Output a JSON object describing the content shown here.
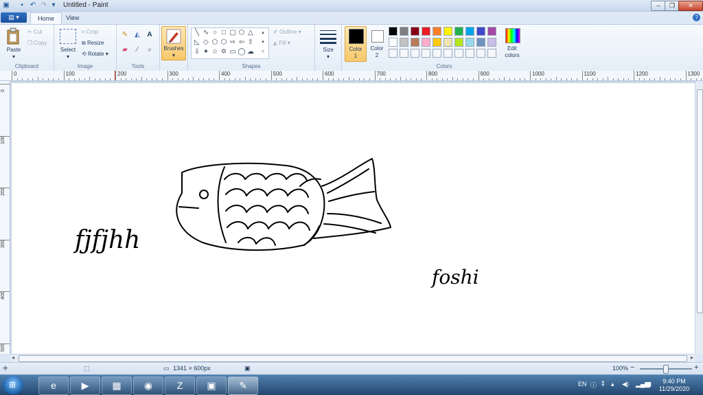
{
  "window": {
    "title": "Untitled - Paint",
    "quick_access": [
      "save-icon",
      "undo-icon",
      "redo-icon",
      "dropdown-icon"
    ],
    "minimize": "–",
    "maximize": "❐",
    "close": "✕"
  },
  "tabs": {
    "file": "▤ ▾",
    "home": "Home",
    "view": "View",
    "help": "?"
  },
  "ribbon": {
    "clipboard": {
      "label": "Clipboard",
      "paste": "Paste",
      "cut": "Cut",
      "copy": "Copy"
    },
    "image": {
      "label": "Image",
      "select": "Select",
      "crop": "Crop",
      "resize": "Resize",
      "rotate": "Rotate ▾"
    },
    "tools": {
      "label": "Tools"
    },
    "brushes": {
      "label": "Brushes"
    },
    "shapes": {
      "label": "Shapes",
      "outline": "Outline ▾",
      "fill": "Fill ▾"
    },
    "size": {
      "label": "Size"
    },
    "color1": {
      "label_line1": "Color",
      "label_line2": "1",
      "value": "#000000"
    },
    "color2": {
      "label_line1": "Color",
      "label_line2": "2",
      "value": "#ffffff"
    },
    "colors": {
      "label": "Colors",
      "row1": [
        "#000000",
        "#7f7f7f",
        "#880015",
        "#ed1c24",
        "#ff7f27",
        "#fff200",
        "#22b14c",
        "#00a2e8",
        "#3f48cc",
        "#a349a4"
      ],
      "row2": [
        "#ffffff",
        "#c3c3c3",
        "#b97a57",
        "#ffaec9",
        "#ffc90e",
        "#efe4b0",
        "#b5e61d",
        "#99d9ea",
        "#7092be",
        "#c8bfe7"
      ],
      "row3": [
        "#f5f7fb",
        "#f5f7fb",
        "#f5f7fb",
        "#f5f7fb",
        "#f5f7fb",
        "#f5f7fb",
        "#f5f7fb",
        "#f5f7fb",
        "#f5f7fb",
        "#f5f7fb"
      ]
    },
    "edit_colors": {
      "line1": "Edit",
      "line2": "colors"
    }
  },
  "ruler": {
    "h_labels": [
      "0",
      "100",
      "200",
      "300",
      "400",
      "500",
      "600",
      "700",
      "800",
      "900",
      "1000",
      "1100",
      "1200",
      "1300"
    ],
    "v_labels": [
      "0",
      "100",
      "200",
      "300",
      "400",
      "500"
    ]
  },
  "canvas": {
    "text_left": "fjfjhh",
    "text_right": "foshi"
  },
  "status": {
    "dimensions": "1341 × 600px",
    "zoom": "100%",
    "zoom_out": "−",
    "zoom_in": "+"
  },
  "taskbar": {
    "apps": [
      {
        "name": "taskbar-ie",
        "glyph": "e"
      },
      {
        "name": "taskbar-media",
        "glyph": "▶"
      },
      {
        "name": "taskbar-explorer",
        "glyph": "▦"
      },
      {
        "name": "taskbar-chrome",
        "glyph": "◉"
      },
      {
        "name": "taskbar-zalo",
        "glyph": "Z"
      },
      {
        "name": "taskbar-remote",
        "glyph": "▣"
      },
      {
        "name": "taskbar-paint",
        "glyph": "✎"
      }
    ],
    "language": "EN",
    "time": "9:40 PM",
    "date": "11/29/2020"
  }
}
